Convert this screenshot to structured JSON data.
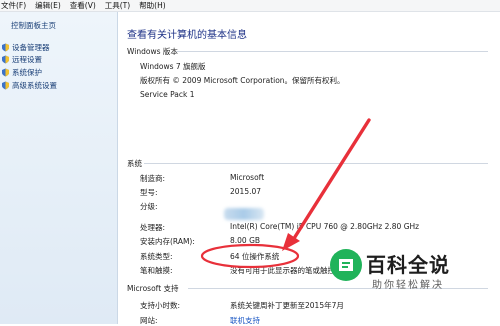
{
  "menubar": {
    "items": [
      "文件(F)",
      "编辑(E)",
      "查看(V)",
      "工具(T)",
      "帮助(H)"
    ]
  },
  "sidebar": {
    "home": "控制面板主页",
    "items": [
      {
        "label": "设备管理器",
        "icon": "device-manager-icon"
      },
      {
        "label": "远程设置",
        "icon": "remote-settings-icon"
      },
      {
        "label": "系统保护",
        "icon": "system-protection-icon"
      },
      {
        "label": "高级系统设置",
        "icon": "advanced-settings-icon"
      }
    ]
  },
  "main": {
    "title": "查看有关计算机的基本信息",
    "edition": {
      "heading": "Windows 版本",
      "name": "Windows 7 旗舰版",
      "copyright": "版权所有 © 2009 Microsoft Corporation。保留所有权利。",
      "service_pack": "Service Pack 1"
    },
    "system": {
      "heading": "系统",
      "rows": [
        {
          "label": "制造商:",
          "value": "Microsoft"
        },
        {
          "label": "型号:",
          "value": "2015.07"
        },
        {
          "label": "分级:",
          "value": ""
        },
        {
          "label": "处理器:",
          "value": "Intel(R) Core(TM) i5 CPU       760  @ 2.80GHz   2.80 GHz"
        },
        {
          "label": "安装内存(RAM):",
          "value": "8.00 GB"
        },
        {
          "label": "系统类型:",
          "value": "64 位操作系统"
        },
        {
          "label": "笔和触摸:",
          "value": "没有可用于此显示器的笔或触控输入"
        }
      ]
    },
    "support": {
      "heading": "Microsoft 支持",
      "rows": [
        {
          "label": "支持小时数:",
          "value": "系统关键周补丁更新至2015年7月"
        },
        {
          "label": "网站:",
          "value": "联机支持"
        }
      ]
    }
  },
  "annotation": {
    "color": "#e8303a"
  },
  "watermark": {
    "title": "百科全说",
    "subtitle": "助你轻松解决",
    "color": "#20b35a"
  }
}
